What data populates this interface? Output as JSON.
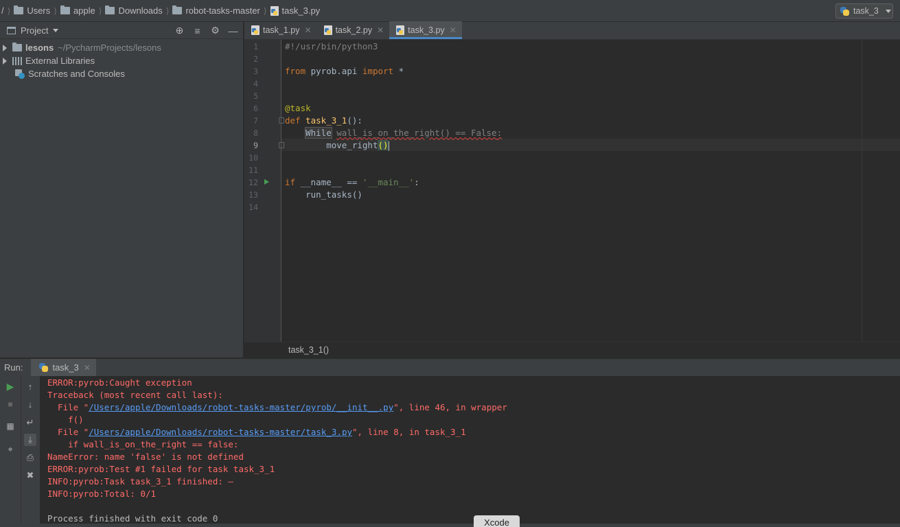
{
  "breadcrumb": {
    "root": "/",
    "items": [
      "Users",
      "apple",
      "Downloads",
      "robot-tasks-master"
    ],
    "file": "task_3.py"
  },
  "run_config": {
    "label": "task_3"
  },
  "project_panel": {
    "title": "Project",
    "tree": [
      {
        "label": "lesons",
        "hint": "~/PycharmProjects/lesons"
      },
      {
        "label": "External Libraries"
      },
      {
        "label": "Scratches and Consoles"
      }
    ]
  },
  "editor": {
    "tabs": [
      {
        "label": "task_1.py",
        "active": false
      },
      {
        "label": "task_2.py",
        "active": false
      },
      {
        "label": "task_3.py",
        "active": true
      }
    ],
    "line_numbers": [
      "1",
      "2",
      "3",
      "4",
      "5",
      "6",
      "7",
      "8",
      "9",
      "10",
      "11",
      "12",
      "13",
      "14"
    ],
    "code": {
      "l1": "#!/usr/bin/python3",
      "l3_kw1": "from",
      "l3_mod": " pyrob.api ",
      "l3_kw2": "import",
      "l3_rest": " *",
      "l6": "@task",
      "l7_kw": "def",
      "l7_fn": "task_3_1",
      "l7_rest": "():",
      "l8_while": "While",
      "l8_err": "wall_is_on_the_right() == False",
      "l8_colon": ":",
      "l9": "move_right",
      "l9_paren": "()",
      "l12_kw": "if",
      "l12_mid": " __name__ == ",
      "l12_str": "'__main__'",
      "l12_colon": ":",
      "l13": "run_tasks()"
    },
    "breadcrumb_footer": "task_3_1()"
  },
  "run_panel": {
    "title": "Run:",
    "tab_label": "task_3",
    "console": {
      "l1": "ERROR:pyrob:Caught exception",
      "l2": "Traceback (most recent call last):",
      "l3_pre": "  File \"",
      "l3_link": "/Users/apple/Downloads/robot-tasks-master/pyrob/__init__.py",
      "l3_post": "\", line 46, in wrapper",
      "l4": "    f()",
      "l5_pre": "  File \"",
      "l5_link": "/Users/apple/Downloads/robot-tasks-master/task_3.py",
      "l5_post": "\", line 8, in task_3_1",
      "l6": "    if wall_is_on_the_right == false:",
      "l7": "NameError: name 'false' is not defined",
      "l8": "ERROR:pyrob:Test #1 failed for task task_3_1",
      "l9": "INFO:pyrob:Task task_3_1 finished: —",
      "l10": "INFO:pyrob:Total: 0/1",
      "l11": "",
      "l12": "Process finished with exit code 0"
    }
  },
  "dock_tooltip": "Xcode",
  "colors": {
    "keyword": "#cc7832",
    "function": "#ffc66d",
    "decorator": "#bbb529",
    "string": "#6a8759",
    "error_text": "#ff6b68",
    "link": "#589df6",
    "active_tab_underline": "#4a88c7"
  }
}
